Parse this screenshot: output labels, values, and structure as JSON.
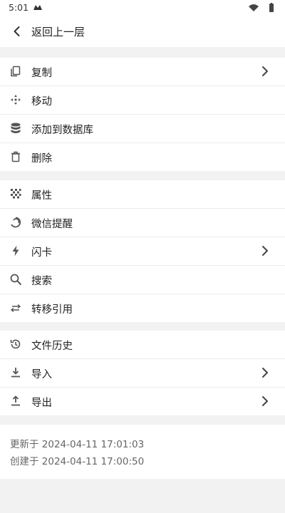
{
  "status_bar": {
    "time": "5:01",
    "app_icon": "notification-app-icon",
    "right_icons": [
      "wifi-icon",
      "battery-icon"
    ]
  },
  "header": {
    "back_icon": "chevron-left-icon",
    "title": "返回上一层"
  },
  "menu_groups": [
    {
      "items": [
        {
          "label": "复制",
          "icon": "copy-icon",
          "has_chevron": true
        },
        {
          "label": "移动",
          "icon": "move-icon",
          "has_chevron": false
        },
        {
          "label": "添加到数据库",
          "icon": "database-icon",
          "has_chevron": false
        },
        {
          "label": "删除",
          "icon": "trash-icon",
          "has_chevron": false
        }
      ]
    },
    {
      "items": [
        {
          "label": "属性",
          "icon": "attributes-icon",
          "has_chevron": false
        },
        {
          "label": "微信提醒",
          "icon": "wechat-reminder-icon",
          "has_chevron": false
        },
        {
          "label": "闪卡",
          "icon": "flash-icon",
          "has_chevron": true
        },
        {
          "label": "搜索",
          "icon": "search-icon",
          "has_chevron": false
        },
        {
          "label": "转移引用",
          "icon": "transfer-icon",
          "has_chevron": false
        }
      ]
    },
    {
      "items": [
        {
          "label": "文件历史",
          "icon": "history-icon",
          "has_chevron": false
        },
        {
          "label": "导入",
          "icon": "import-icon",
          "has_chevron": true
        },
        {
          "label": "导出",
          "icon": "export-icon",
          "has_chevron": true
        }
      ]
    }
  ],
  "info": {
    "updated": "更新于 2024-04-11 17:01:03",
    "created": "创建于 2024-04-11 17:00:50"
  }
}
